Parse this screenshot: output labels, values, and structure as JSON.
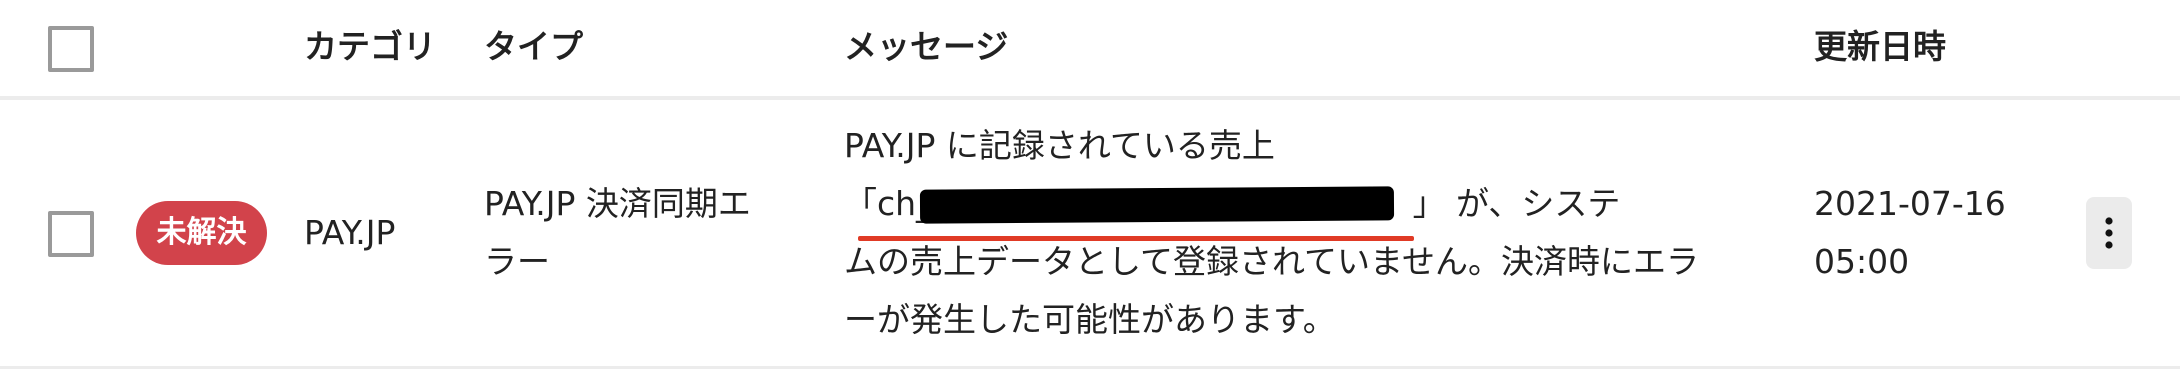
{
  "table": {
    "headers": {
      "category": "カテゴリ",
      "type": "タイプ",
      "message": "メッセージ",
      "updated": "更新日時"
    },
    "rows": [
      {
        "status": "未解決",
        "status_color": "#d2434b",
        "category": "PAY.JP",
        "type_line1": "PAY.JP 決済同期エ",
        "type_line2": "ラー",
        "message_line1": "PAY.JP に記録されている売上",
        "message_txn_open": "「ch_",
        "message_txn_close": "」",
        "message_line2_rest": " が、システ",
        "message_line3": "ムの売上データとして登録されていません。決済時にエラ",
        "message_line4": "ーが発生した可能性があります。",
        "updated_date": "2021-07-16",
        "updated_time": "05:00",
        "actions_icon": "more-vertical-icon"
      }
    ]
  },
  "colors": {
    "status_unresolved": "#d2434b",
    "highlight_underline": "#e03a25",
    "redaction": "#000000"
  }
}
